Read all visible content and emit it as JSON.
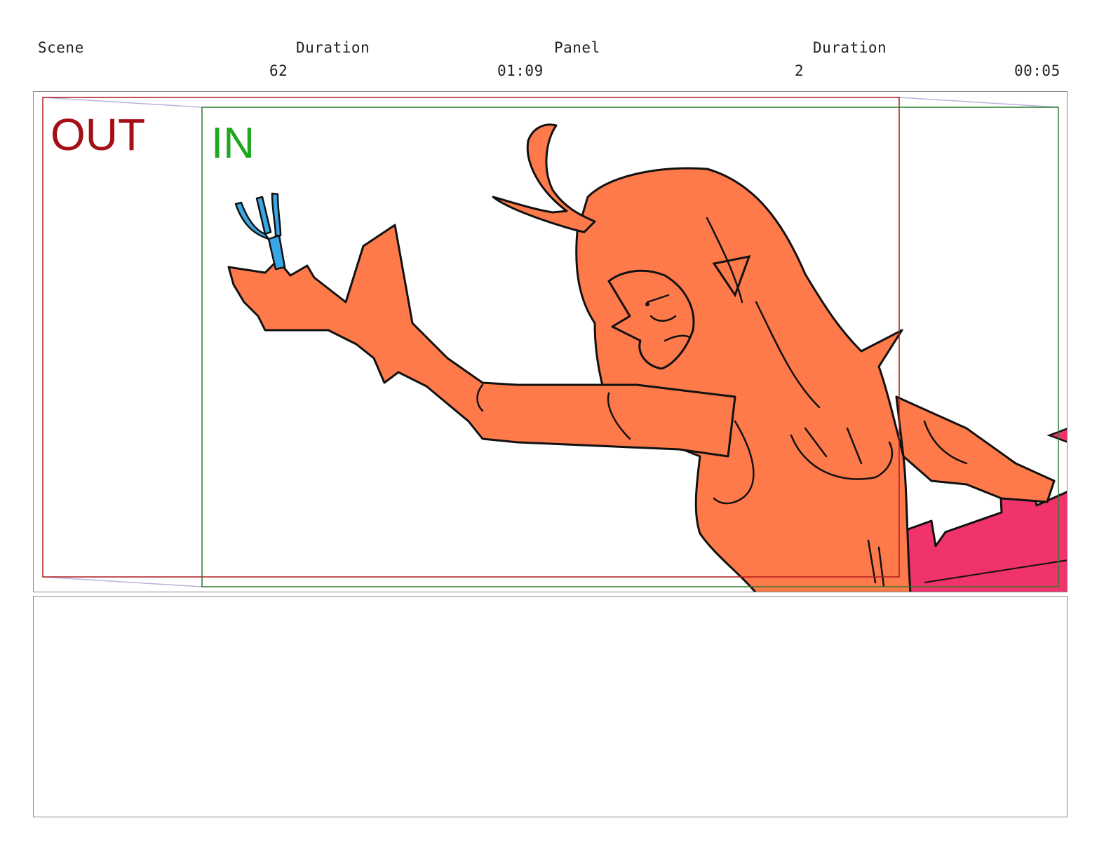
{
  "header": {
    "scene_label": "Scene",
    "duration_label": "Duration",
    "panel_label": "Panel",
    "panel_duration_label": "Duration",
    "scene_value": "62",
    "scene_duration_value": "01:09",
    "panel_value": "2",
    "panel_duration_value": "00:05"
  },
  "panel": {
    "camera_out_label": "OUT",
    "camera_in_label": "IN",
    "colors": {
      "camera_out": "#a30f14",
      "camera_in": "#1fa71f",
      "character_fill": "#ff7a4a",
      "prop_fill": "#f0336a",
      "fork_fill": "#39a6e6",
      "linework": "#111111"
    },
    "icons": [
      "fork-icon"
    ]
  },
  "notes": {
    "text": ""
  }
}
